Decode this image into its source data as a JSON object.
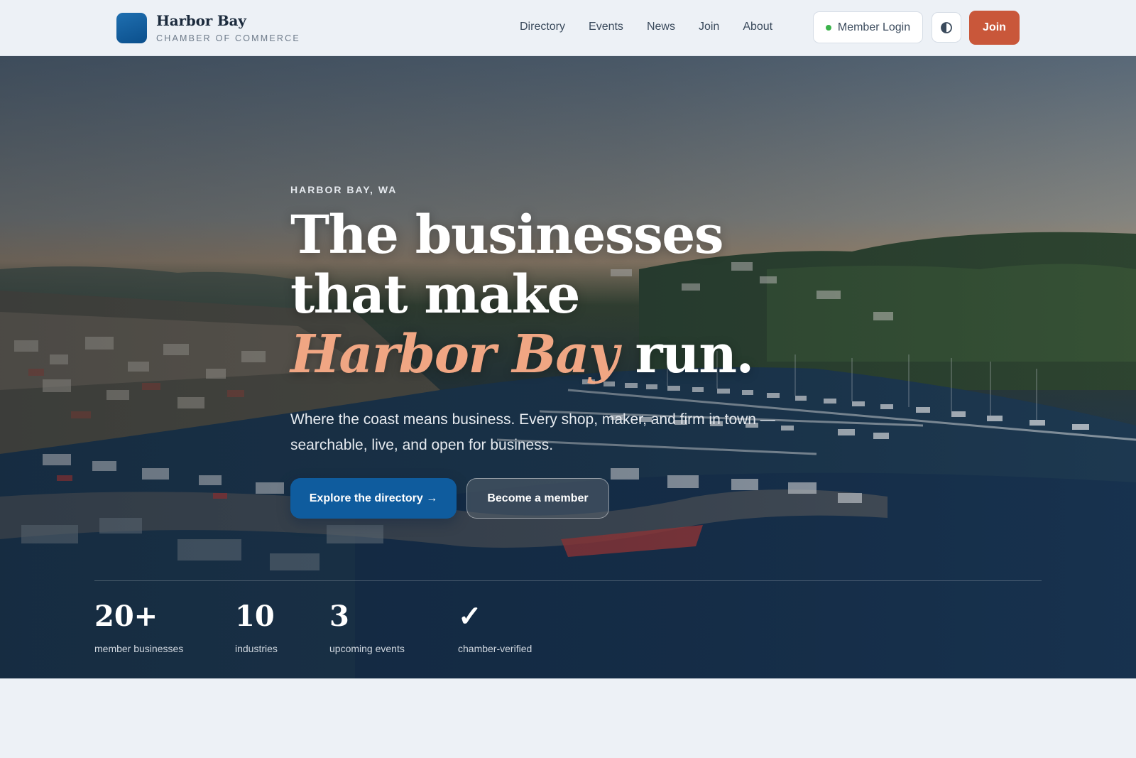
{
  "brand": {
    "name": "Harbor Bay",
    "subtitle": "CHAMBER OF COMMERCE",
    "mark_color": "#0b4f8c"
  },
  "nav": {
    "items": [
      {
        "label": "Directory"
      },
      {
        "label": "Events"
      },
      {
        "label": "News"
      },
      {
        "label": "Join"
      },
      {
        "label": "About"
      }
    ]
  },
  "header_actions": {
    "login_label": "Member Login",
    "login_status_color": "#3bb34a",
    "theme_toggle_icon": "contrast-icon",
    "join_label": "Join",
    "join_color": "#c9573a"
  },
  "hero": {
    "eyebrow": "HARBOR BAY, WA",
    "headline_line1": "The businesses",
    "headline_line2": "that make",
    "headline_accent": "Harbor Bay",
    "headline_tail": " run.",
    "accent_color": "#f0a683",
    "lede": "Where the coast means business. Every shop, maker, and firm in town — searchable, live, and open for business.",
    "primary_cta": "Explore the directory →",
    "primary_color": "#0f5c9e",
    "secondary_cta": "Become a member",
    "background": "aerial-harbor-photo"
  },
  "stats": [
    {
      "value": "20+",
      "label": "member businesses"
    },
    {
      "value": "10",
      "label": "industries"
    },
    {
      "value": "3",
      "label": "upcoming events"
    },
    {
      "value": "✓",
      "label": "chamber-verified"
    }
  ]
}
